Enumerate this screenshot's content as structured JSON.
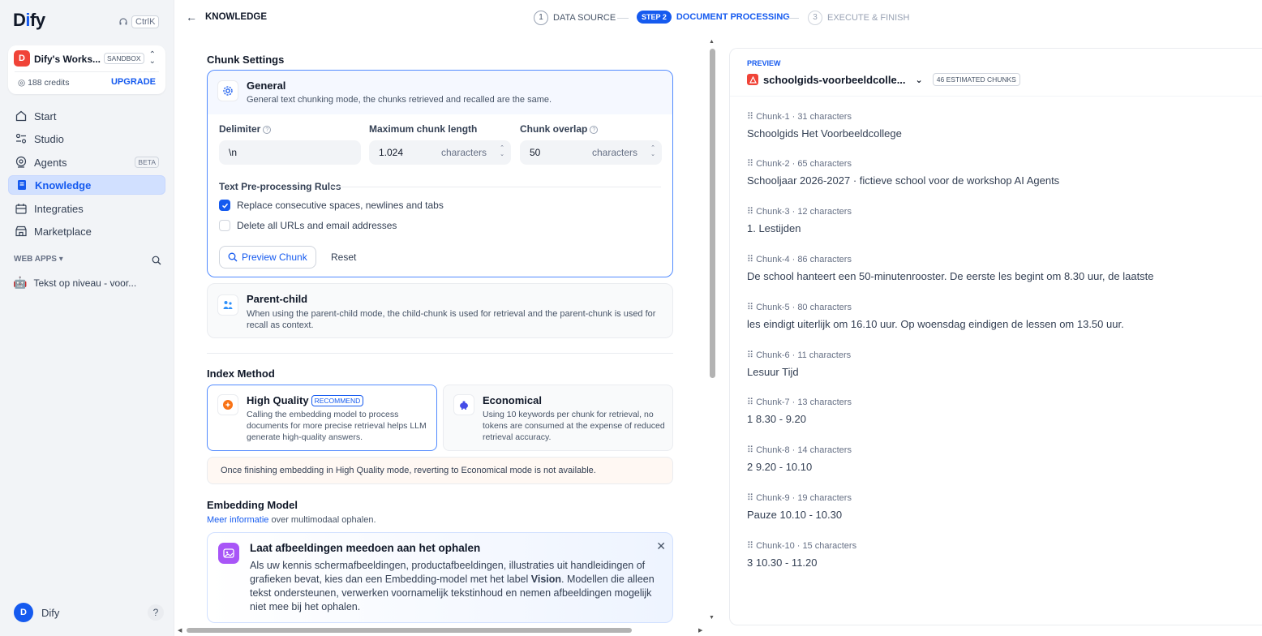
{
  "sidebar": {
    "logo_a": "D",
    "logo_b": "i",
    "logo_c": "fy",
    "shortcut": "CtrlK",
    "workspace": {
      "avatar": "D",
      "name": "Dify's Works...",
      "plan": "SANDBOX",
      "credits": "188 credits",
      "upgrade": "UPGRADE"
    },
    "nav": [
      {
        "label": "Start",
        "icon": "home-icon"
      },
      {
        "label": "Studio",
        "icon": "studio-icon"
      },
      {
        "label": "Agents",
        "icon": "agents-icon",
        "badge": "BETA"
      },
      {
        "label": "Knowledge",
        "icon": "knowledge-icon"
      },
      {
        "label": "Integraties",
        "icon": "integrations-icon"
      },
      {
        "label": "Marketplace",
        "icon": "marketplace-icon"
      }
    ],
    "web_apps_label": "WEB APPS",
    "web_app": {
      "emoji": "🤖",
      "label": "Tekst op niveau - voor..."
    },
    "user": {
      "avatar": "D",
      "name": "Dify"
    },
    "help": "?"
  },
  "topbar": {
    "back_label": "KNOWLEDGE",
    "steps": [
      {
        "num": "1",
        "label": "DATA SOURCE"
      },
      {
        "num": "STEP 2",
        "label": "DOCUMENT PROCESSING"
      },
      {
        "num": "3",
        "label": "EXECUTE & FINISH"
      }
    ]
  },
  "chunk_settings": {
    "title": "Chunk Settings",
    "general": {
      "title": "General",
      "desc": "General text chunking mode, the chunks retrieved and recalled are the same."
    },
    "delimiter": {
      "label": "Delimiter",
      "value": "\\n"
    },
    "max_length": {
      "label": "Maximum chunk length",
      "value": "1.024",
      "unit": "characters"
    },
    "overlap": {
      "label": "Chunk overlap",
      "value": "50",
      "unit": "characters"
    },
    "rules_title": "Text Pre-processing Rules",
    "rule1": "Replace consecutive spaces, newlines and tabs",
    "rule2": "Delete all URLs and email addresses",
    "preview_btn": "Preview Chunk",
    "reset_btn": "Reset",
    "parent_child": {
      "title": "Parent-child",
      "desc": "When using the parent-child mode, the child-chunk is used for retrieval and the parent-chunk is used for recall as context."
    }
  },
  "index_method": {
    "title": "Index Method",
    "high": {
      "title": "High Quality",
      "badge": "RECOMMEND",
      "desc": "Calling the embedding model to process documents for more precise retrieval helps LLM generate high-quality answers."
    },
    "economical": {
      "title": "Economical",
      "desc": "Using 10 keywords per chunk for retrieval, no tokens are consumed at the expense of reduced retrieval accuracy."
    },
    "warning": "Once finishing embedding in High Quality mode, reverting to Economical mode is not available."
  },
  "embedding": {
    "title": "Embedding Model",
    "link": "Meer informatie",
    "link_suffix": " over multimodaal ophalen.",
    "banner_title": "Laat afbeeldingen meedoen aan het ophalen",
    "banner_desc_1": "Als uw kennis schermafbeeldingen, productafbeeldingen, illustraties uit handleidingen of grafieken bevat, kies dan een Embedding-model met het label ",
    "banner_desc_bold": "Vision",
    "banner_desc_2": ". Modellen die alleen tekst ondersteunen, verwerken voornamelijk tekstinhoud en nemen afbeeldingen mogelijk niet mee bij het ophalen."
  },
  "preview": {
    "label": "PREVIEW",
    "file": "schoolgids-voorbeeldcolle...",
    "estimate": "46 ESTIMATED CHUNKS",
    "chunks": [
      {
        "id": "Chunk-1",
        "chars": "31 characters",
        "text": "Schoolgids Het Voorbeeldcollege"
      },
      {
        "id": "Chunk-2",
        "chars": "65 characters",
        "text": "Schooljaar 2026-2027 · fictieve school voor de workshop AI Agents"
      },
      {
        "id": "Chunk-3",
        "chars": "12 characters",
        "text": "1. Lestijden"
      },
      {
        "id": "Chunk-4",
        "chars": "86 characters",
        "text": "De school hanteert een 50-minutenrooster. De eerste les begint om 8.30 uur, de laatste"
      },
      {
        "id": "Chunk-5",
        "chars": "80 characters",
        "text": "les eindigt uiterlijk om 16.10 uur. Op woensdag eindigen de lessen om 13.50 uur."
      },
      {
        "id": "Chunk-6",
        "chars": "11 characters",
        "text": "Lesuur Tijd"
      },
      {
        "id": "Chunk-7",
        "chars": "13 characters",
        "text": "1 8.30 - 9.20"
      },
      {
        "id": "Chunk-8",
        "chars": "14 characters",
        "text": "2 9.20 - 10.10"
      },
      {
        "id": "Chunk-9",
        "chars": "19 characters",
        "text": "Pauze 10.10 - 10.30"
      },
      {
        "id": "Chunk-10",
        "chars": "15 characters",
        "text": "3 10.30 - 11.20"
      }
    ]
  }
}
